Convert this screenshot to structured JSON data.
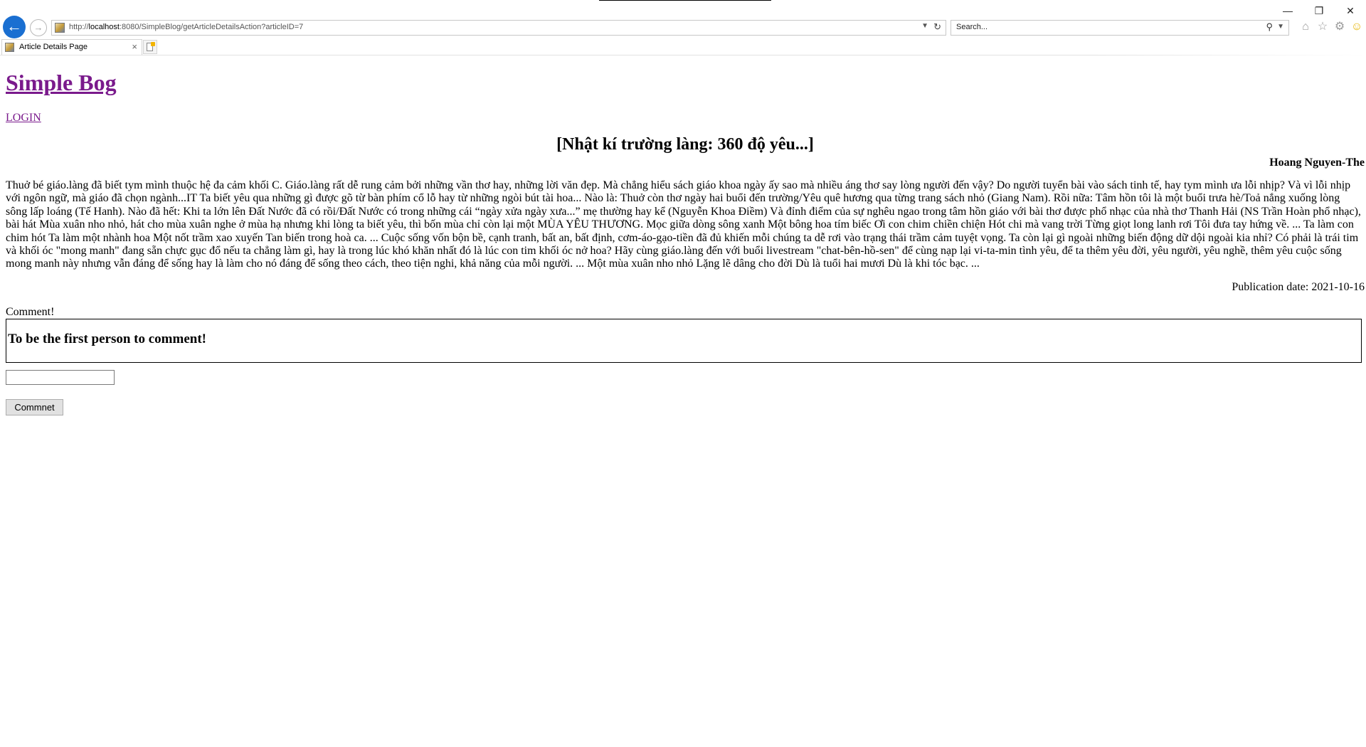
{
  "browser": {
    "url_prefix": "http://",
    "url_host": "localhost",
    "url_rest": ":8080/SimpleBlog/getArticleDetailsAction?articleID=7",
    "search_placeholder": "Search...",
    "tab_title": "Article Details Page",
    "window_controls": {
      "minimize": "—",
      "restore": "❐",
      "close": "✕"
    },
    "icons": [
      "back-arrow-icon",
      "forward-arrow-icon",
      "home-icon",
      "star-icon",
      "gear-icon",
      "smiley-icon"
    ]
  },
  "site": {
    "title": "Simple Bog",
    "login_label": "LOGIN"
  },
  "article": {
    "title": "[Nhật kí trường làng: 360 độ yêu...]",
    "author": "Hoang Nguyen-The",
    "body": "Thuở bé giáo.làng đã biết tym mình thuộc hệ đa cảm khối C. Giáo.làng rất dễ rung cảm bởi những vần thơ hay, những lời văn đẹp. Mà chẳng hiểu sách giáo khoa ngày ấy sao mà nhiều áng thơ say lòng người đến vậy? Do người tuyển bài vào sách tinh tế, hay tym mình ưa lỗi nhịp? Và vì lỗi nhịp với ngôn ngữ, mà giáo đã chọn ngành...IT Ta biết yêu qua những gì được gõ từ bàn phím cổ lỗ hay từ những ngòi bút tài hoa... Nào là: Thuở còn thơ ngày hai buổi đến trường/Yêu quê hương qua từng trang sách nhỏ (Giang Nam). Rồi nữa: Tâm hồn tôi là một buổi trưa hè/Toả nắng xuống lòng sông lấp loáng (Tế Hanh). Nào đã hết: Khi ta lớn lên Đất Nước đã có rồi/Đất Nước có trong những cái “ngày xửa ngày xưa...” mẹ thường hay kể (Nguyễn Khoa Điềm) Và đỉnh điểm của sự nghêu ngao trong tâm hồn giáo với bài thơ được phổ nhạc của nhà thơ Thanh Hải (NS Trần Hoàn phổ nhạc), bài hát Mùa xuân nho nhỏ, hát cho mùa xuân nghe ở mùa hạ nhưng khi lòng ta biết yêu, thì bốn mùa chỉ còn lại một MÙA YÊU THƯƠNG. Mọc giữa dòng sông xanh Một bông hoa tím biếc Ơi con chim chiền chiện Hót chi mà vang trời Từng giọt long lanh rơi Tôi đưa tay hứng về. ... Ta làm con chim hót Ta làm một nhành hoa Một nốt trầm xao xuyến Tan biến trong hoà ca. ... Cuộc sống vốn bộn bề, cạnh tranh, bất an, bất định, cơm-áo-gạo-tiền đã đủ khiến mỗi chúng ta dễ rơi vào trạng thái trầm cảm tuyệt vọng. Ta còn lại gì ngoài những biến động dữ dội ngoài kia nhỉ? Có phải là trái tim và khối óc \"mong manh\" đang sẵn chực gục đổ nếu ta chẳng làm gì, hay là trong lúc khó khăn nhất đó là lúc con tim khối óc nở hoa? Hãy cùng giáo.làng đến với buổi livestream \"chat-bên-hồ-sen\" để cùng nạp lại vi-ta-min tình yêu, để ta thêm yêu đời, yêu người, yêu nghề, thêm yêu cuộc sống mong manh này nhưng vẫn đáng để sống hay là làm cho nó đáng để sống theo cách, theo tiện nghi, khả năng của mỗi người. ... Một mùa xuân nho nhỏ Lặng lẽ dâng cho đời Dù là tuổi hai mươi Dù là khi tóc bạc. ...",
    "publication": "Publication date: 2021-10-16"
  },
  "comments": {
    "label": "Comment!",
    "empty_message": "To be the first person to comment!",
    "input_value": "",
    "button_label": "Commnet"
  }
}
